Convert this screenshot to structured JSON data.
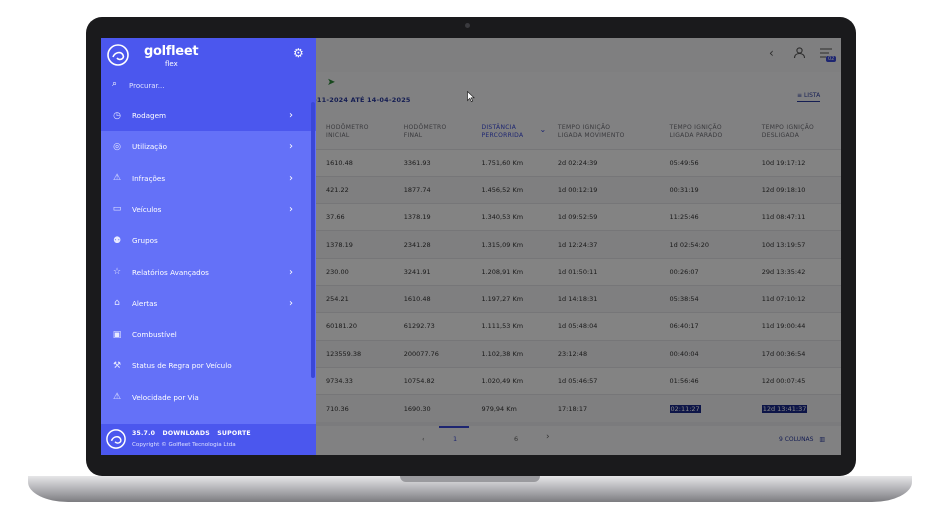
{
  "brand": {
    "name": "golfleet",
    "sub": "flex"
  },
  "search": {
    "placeholder": "Procurar..."
  },
  "menu": [
    {
      "label": "Rodagem",
      "icon": "speedometer-icon",
      "chevron": true
    },
    {
      "label": "Utilização",
      "icon": "globe-icon",
      "chevron": true
    },
    {
      "label": "Infrações",
      "icon": "warning-icon",
      "chevron": true
    },
    {
      "label": "Veículos",
      "icon": "car-icon",
      "chevron": true
    },
    {
      "label": "Grupos",
      "icon": "group-icon",
      "chevron": false
    },
    {
      "label": "Relatórios Avançados",
      "icon": "star-icon",
      "chevron": true
    },
    {
      "label": "Alertas",
      "icon": "bell-icon",
      "chevron": true
    },
    {
      "label": "Combustível",
      "icon": "fuel-icon",
      "chevron": false
    },
    {
      "label": "Status de Regra por Veículo",
      "icon": "gavel-icon",
      "chevron": false
    },
    {
      "label": "Velocidade por Via",
      "icon": "road-warning-icon",
      "chevron": false
    }
  ],
  "footer": {
    "version": "35.7.0",
    "downloads": "DOWNLOADS",
    "support": "SUPORTE",
    "copyright": "Copyright © Golfleet Tecnologia Ltda"
  },
  "filter": {
    "range": "-11-2024 ATÉ 14-04-2025",
    "view_label": "LISTA"
  },
  "topbar": {
    "notification_count": "02"
  },
  "table": {
    "headers": [
      [
        "HODÔMETRO",
        "INICIAL"
      ],
      [
        "HODÔMETRO",
        "FINAL"
      ],
      [
        "DISTÂNCIA",
        "PERCORRIDA"
      ],
      [
        "TEMPO IGNIÇÃO",
        "LIGADA MOVIMENTO"
      ],
      [
        "TEMPO IGNIÇÃO",
        "LIGADA PARADO"
      ],
      [
        "TEMPO IGNIÇÃO",
        "DESLIGADA"
      ]
    ],
    "rows": [
      [
        "1610.48",
        "3361.93",
        "1.751,60 Km",
        "2d 02:24:39",
        "05:49:56",
        "10d 19:17:12"
      ],
      [
        "421.22",
        "1877.74",
        "1.456,52 Km",
        "1d 00:12:19",
        "00:31:19",
        "12d 09:18:10"
      ],
      [
        "37.66",
        "1378.19",
        "1.340,53 Km",
        "1d 09:52:59",
        "11:25:46",
        "11d 08:47:11"
      ],
      [
        "1378.19",
        "2341.28",
        "1.315,09 Km",
        "1d 12:24:37",
        "1d 02:54:20",
        "10d 13:19:57"
      ],
      [
        "230.00",
        "3241.91",
        "1.208,91 Km",
        "1d 01:50:11",
        "00:26:07",
        "29d 13:35:42"
      ],
      [
        "254.21",
        "1610.48",
        "1.197,27 Km",
        "1d 14:18:31",
        "05:38:54",
        "11d 07:10:12"
      ],
      [
        "60181.20",
        "61292.73",
        "1.111,53 Km",
        "1d 05:48:04",
        "06:40:17",
        "11d 19:00:44"
      ],
      [
        "123559.38",
        "200077.76",
        "1.102,38 Km",
        "23:12:48",
        "00:40:04",
        "17d 00:36:54"
      ],
      [
        "9734.33",
        "10754.82",
        "1.020,49 Km",
        "1d 05:46:57",
        "01:56:46",
        "12d 00:07:45"
      ],
      [
        "710.36",
        "1690.30",
        "979,94 Km",
        "17:18:17",
        "02:11:27",
        "12d 13:41:37"
      ]
    ]
  },
  "pagination": {
    "current": "1",
    "last": "6",
    "columns_label": "9 COLUNAS"
  }
}
